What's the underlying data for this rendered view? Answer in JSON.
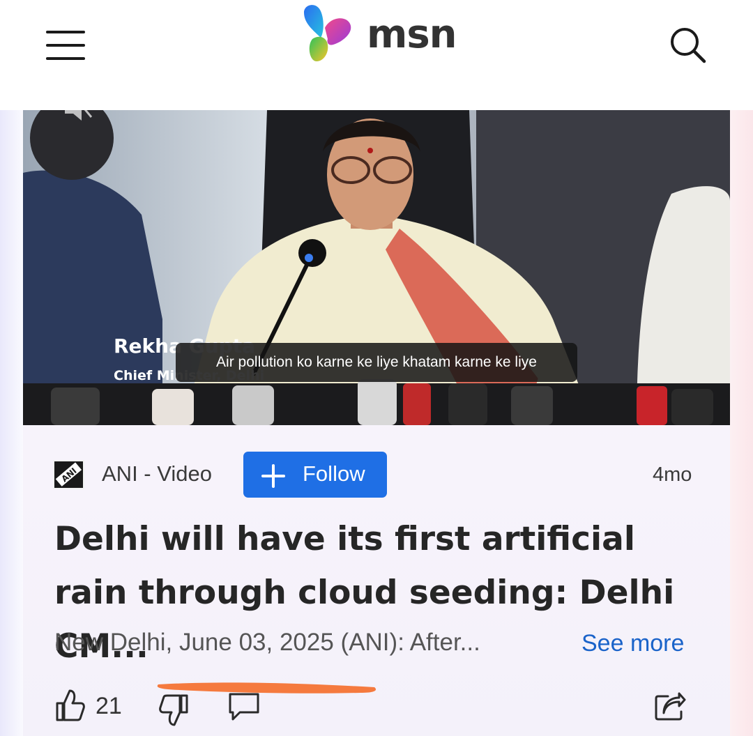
{
  "header": {
    "brand": "msn",
    "menu_icon": "hamburger-menu-icon",
    "search_icon": "search-icon"
  },
  "video": {
    "caption": "Air pollution ko karne ke liye khatam karne ke liye",
    "lower_third_name": "Rekha Gupta",
    "lower_third_role": "Chief Minister, Delhi",
    "mute_icon": "mute-icon"
  },
  "article": {
    "source": "ANI - Video",
    "follow_label": "Follow",
    "time_ago": "4mo",
    "headline": "Delhi will have its first artificial rain through cloud seeding: Delhi CM...",
    "snippet": "New Delhi, June 03, 2025 (ANI): After...",
    "see_more": "See more"
  },
  "actions": {
    "like_count": "21",
    "like_icon": "thumbs-up-icon",
    "dislike_icon": "thumbs-down-icon",
    "comment_icon": "comment-icon",
    "share_icon": "share-icon"
  },
  "colors": {
    "accent": "#1f6fe5",
    "link": "#1a63c9",
    "scribble": "#f57a3e"
  }
}
